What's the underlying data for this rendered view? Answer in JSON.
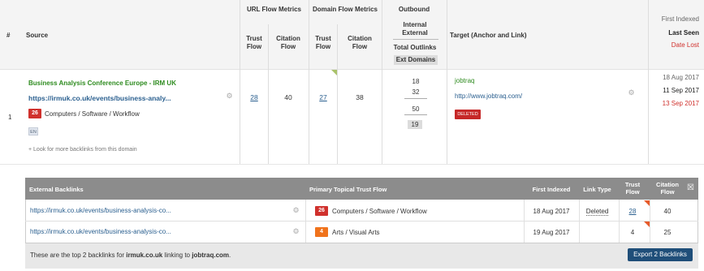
{
  "header": {
    "index_col": "#",
    "source_col": "Source",
    "url_flow_group": "URL Flow Metrics",
    "domain_flow_group": "Domain Flow Metrics",
    "outbound_group": "Outbound",
    "url_trust_flow": [
      "Trust",
      "Flow"
    ],
    "url_citation_flow": [
      "Citation",
      "Flow"
    ],
    "domain_trust_flow": [
      "Trust",
      "Flow"
    ],
    "domain_citation_flow": [
      "Citation",
      "Flow"
    ],
    "internal_external": [
      "Internal",
      "External"
    ],
    "total_outlinks": "Total Outlinks",
    "ext_domains": "Ext Domains",
    "target_col": "Target (Anchor and Link)",
    "first_indexed": "First Indexed",
    "last_seen": "Last Seen",
    "date_lost": "Date Lost"
  },
  "row": {
    "index": "1",
    "title": "Business Analysis Conference Europe - IRM UK",
    "url": "https://irmuk.co.uk/events/business-analy...",
    "category_score": "26",
    "category": "Computers / Software / Workflow",
    "lang": "EN",
    "more_backlinks": "+ Look for more backlinks from this domain",
    "url_trust_flow": "28",
    "url_citation_flow": "40",
    "domain_trust_flow": "27",
    "domain_citation_flow": "38",
    "internal": "18",
    "external": "32",
    "total_outlinks": "50",
    "ext_domains": "19",
    "anchor": "jobtraq",
    "target_url": "http://www.jobtraq.com/",
    "status_badge": "DELETED",
    "first_indexed": "18 Aug 2017",
    "last_seen": "11 Sep 2017",
    "date_lost": "13 Sep 2017"
  },
  "backlinks": {
    "headers": {
      "external": "External Backlinks",
      "topical": "Primary Topical Trust Flow",
      "first_indexed": "First Indexed",
      "link_type": "Link Type",
      "trust_flow": [
        "Trust",
        "Flow"
      ],
      "citation_flow": [
        "Citation",
        "Flow"
      ],
      "close": "☒"
    },
    "rows": [
      {
        "url": "https://irmuk.co.uk/events/business-analysis-co...",
        "score": "26",
        "topic": "Computers / Software / Workflow",
        "first_indexed": "18 Aug 2017",
        "link_type": "Deleted",
        "trust_flow": "28",
        "citation_flow": "40"
      },
      {
        "url": "https://irmuk.co.uk/events/business-analysis-co...",
        "score": "4",
        "topic": "Arts / Visual Arts",
        "first_indexed": "19 Aug 2017",
        "link_type": "",
        "trust_flow": "4",
        "citation_flow": "25"
      }
    ],
    "footer_prefix": "These are the top 2 backlinks for ",
    "footer_domain": "irmuk.co.uk",
    "footer_mid": " linking to ",
    "footer_target": "jobtraq.com",
    "footer_suffix": ".",
    "export_label": "Export 2 Backlinks"
  },
  "colors": {
    "title_green": "#2e8b1f",
    "date_lost_red": "#d0312d",
    "category_red": "#d0312d",
    "category_orange": "#f0731c",
    "header_gray": "#8c8c8c",
    "export_blue": "#1f4e79"
  }
}
